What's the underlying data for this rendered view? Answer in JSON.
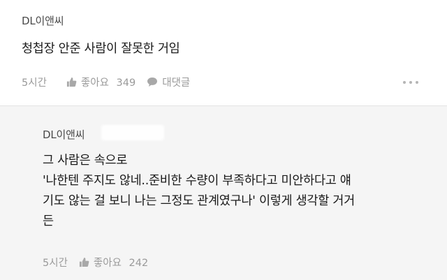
{
  "comment": {
    "author": "DL이앤씨",
    "text": "청첩장 안준 사람이 잘못한 거임",
    "time": "5시간",
    "like_label": "좋아요",
    "like_count": "349",
    "reply_label": "대댓글"
  },
  "reply": {
    "author": "DL이앤씨",
    "lines": [
      "그 사람은 속으로",
      "'나한텐 주지도 않네..준비한 수량이 부족하다고 미안하다고 얘",
      "기도 않는 걸 보니 나는 그정도 관계였구나' 이렇게 생각할 거거",
      "든"
    ],
    "time": "5시간",
    "like_label": "좋아요",
    "like_count": "242"
  },
  "icons": {
    "like": "thumbs-up-icon",
    "reply": "speech-bubble-icon",
    "more": "more-options-icon"
  },
  "colors": {
    "reply_background": "#f5f5f5",
    "meta_text": "#9a9a9a"
  }
}
